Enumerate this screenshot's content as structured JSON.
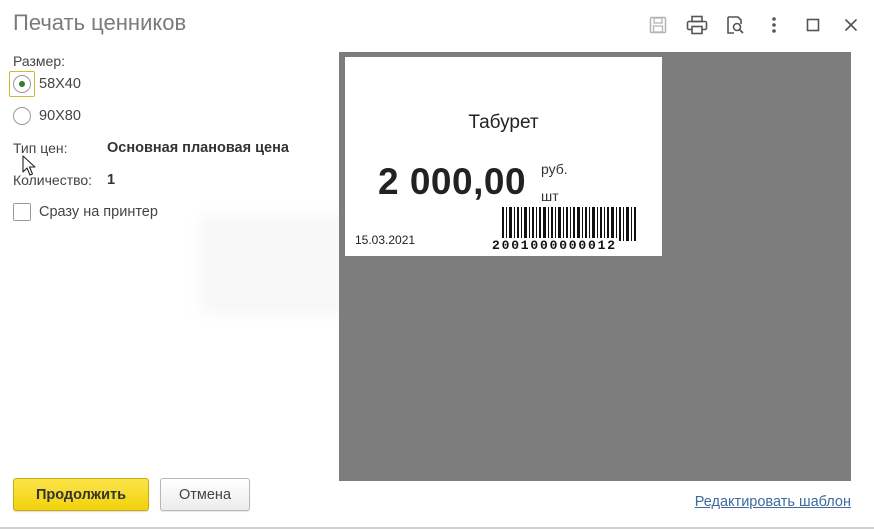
{
  "window": {
    "title": "Печать ценников"
  },
  "form": {
    "size_label": "Размер:",
    "size_options": [
      {
        "label": "58X40",
        "selected": true
      },
      {
        "label": "90X80",
        "selected": false
      }
    ],
    "price_type_label": "Тип цен:",
    "price_type_value": "Основная плановая цена",
    "quantity_label": "Количество:",
    "quantity_value": "1",
    "print_direct_label": "Сразу на принтер",
    "print_direct_checked": false
  },
  "preview": {
    "product_name": "Табурет",
    "price": "2 000,00",
    "currency": "руб.",
    "unit": "шт",
    "date": "15.03.2021",
    "barcode": "2001000000012"
  },
  "buttons": {
    "continue": "Продолжить",
    "cancel": "Отмена"
  },
  "links": {
    "edit_template": "Редактировать шаблон"
  },
  "colors": {
    "primary_button": "#f2d20b",
    "preview_bg": "#7d7d7d",
    "link": "#3f6a9e",
    "radio_dot": "#2f7d2f"
  }
}
